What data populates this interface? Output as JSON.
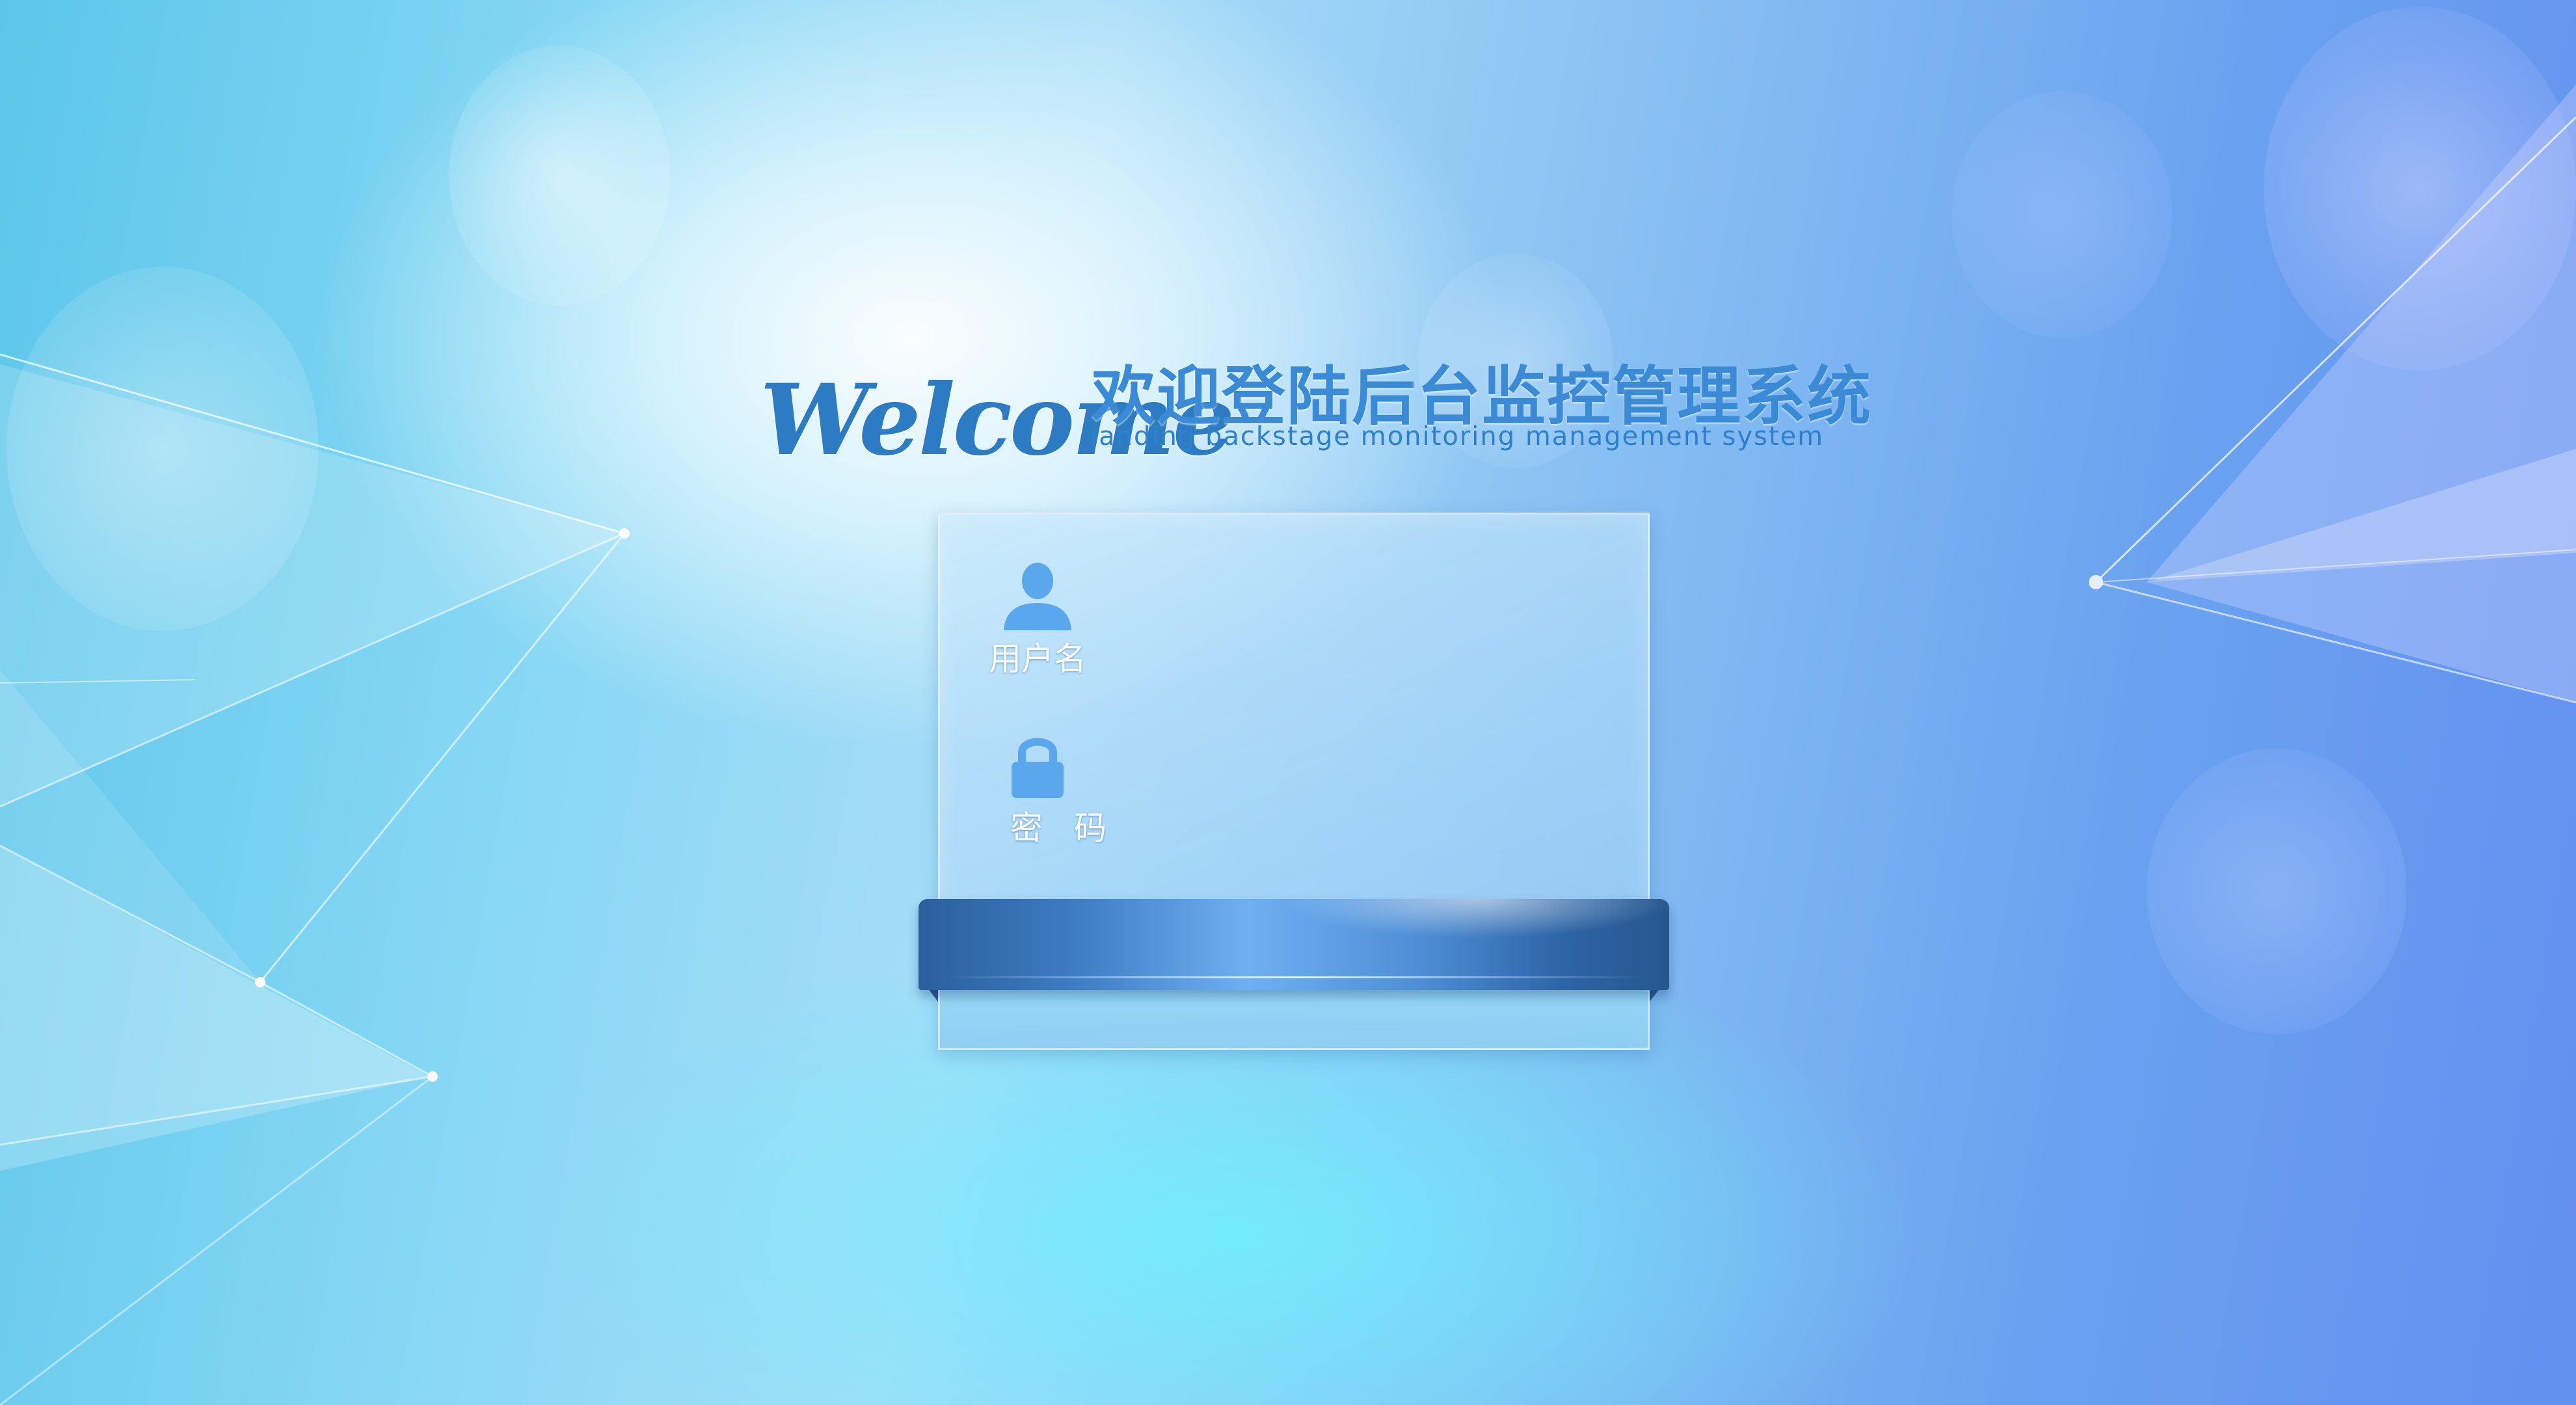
{
  "header": {
    "welcome": "Welcome",
    "title_cn": "欢迎登陆后台监控管理系统",
    "title_en": "landing backstage monitoring management system"
  },
  "login": {
    "username_label": "用户名",
    "password_label": "密码",
    "username_icon": "user-icon",
    "password_icon": "lock-icon"
  },
  "colors": {
    "title": "#3a8ad6",
    "welcome": "#2d7bc2",
    "ribbon_dark": "#2a5f9c",
    "ribbon_light": "#6eb0f2"
  }
}
